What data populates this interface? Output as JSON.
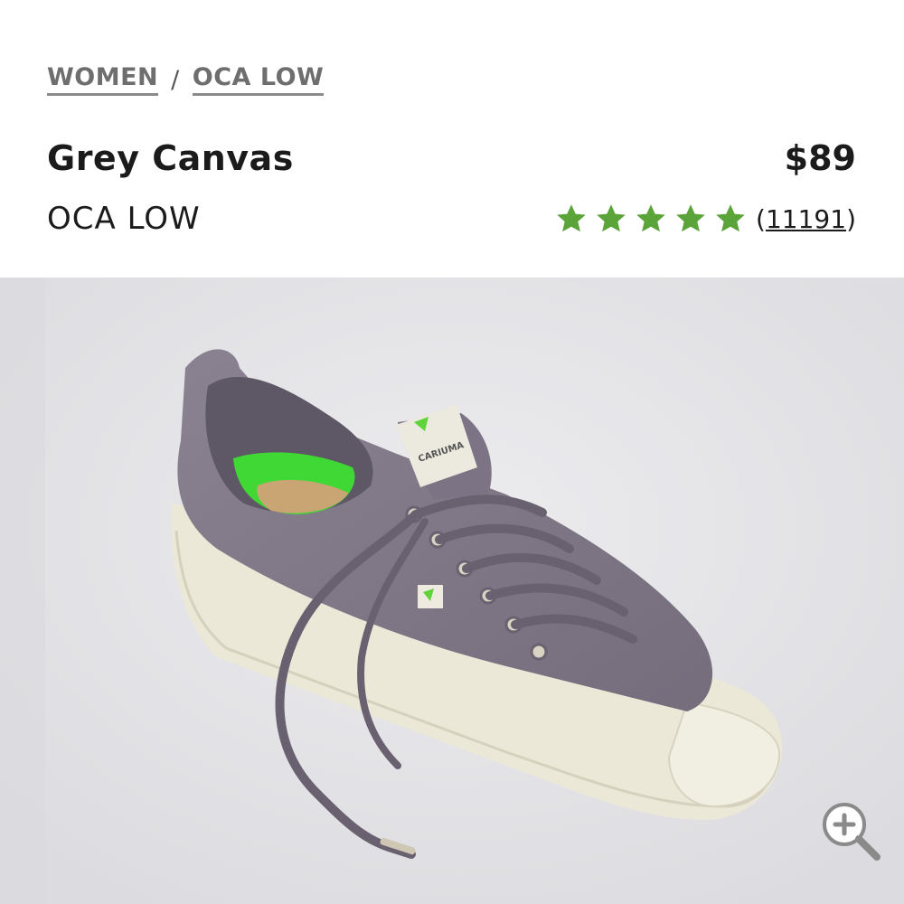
{
  "breadcrumb": {
    "items": [
      "WOMEN",
      "OCA LOW"
    ],
    "separator": "/"
  },
  "product": {
    "title": "Grey Canvas",
    "model": "OCA LOW",
    "price": "$89",
    "rating": {
      "stars": 5,
      "max": 5,
      "count_open": "(",
      "count": "11191",
      "count_close": ")"
    }
  },
  "brand_tag": "CARIUMA",
  "colors": {
    "star": "#5aa43a",
    "shoe_upper": "#857d8c",
    "sole": "#ece8d8",
    "insole_accent": "#3fd834",
    "background": "#e3e3e7"
  },
  "icons": {
    "zoom": "zoom-in-icon",
    "star": "star-icon"
  }
}
